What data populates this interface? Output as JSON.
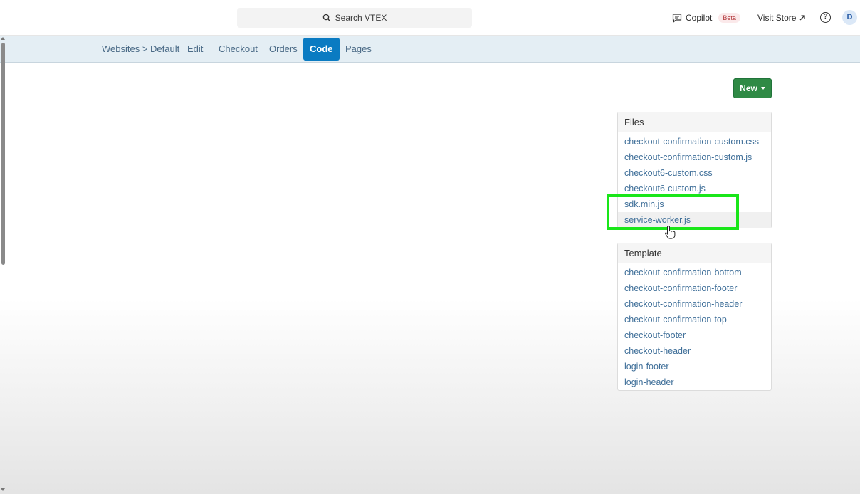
{
  "topbar": {
    "search_label": "Search VTEX",
    "copilot_label": "Copilot",
    "beta_label": "Beta",
    "visit_store_label": "Visit Store",
    "help_glyph": "?",
    "avatar_initial": "D",
    "icons": [
      "search-icon",
      "copilot-icon",
      "external-link-icon",
      "help-icon"
    ]
  },
  "nav": {
    "items": [
      {
        "label": "Websites > Default"
      },
      {
        "label": "Edit"
      },
      {
        "label": "Checkout"
      },
      {
        "label": "Orders"
      },
      {
        "label": "Code",
        "active": true
      },
      {
        "label": "Pages"
      }
    ]
  },
  "actions": {
    "new_label": "New"
  },
  "files_panel": {
    "title": "Files",
    "items": [
      "checkout-confirmation-custom.css",
      "checkout-confirmation-custom.js",
      "checkout6-custom.css",
      "checkout6-custom.js",
      "sdk.min.js",
      "service-worker.js"
    ]
  },
  "template_panel": {
    "title": "Template",
    "items": [
      "checkout-confirmation-bottom",
      "checkout-confirmation-footer",
      "checkout-confirmation-header",
      "checkout-confirmation-top",
      "checkout-footer",
      "checkout-header",
      "login-footer",
      "login-header"
    ]
  },
  "colors": {
    "accent": "#0a7bc2",
    "new_button": "#2f8a45",
    "highlight": "#19e619",
    "link": "#3f6f99"
  }
}
